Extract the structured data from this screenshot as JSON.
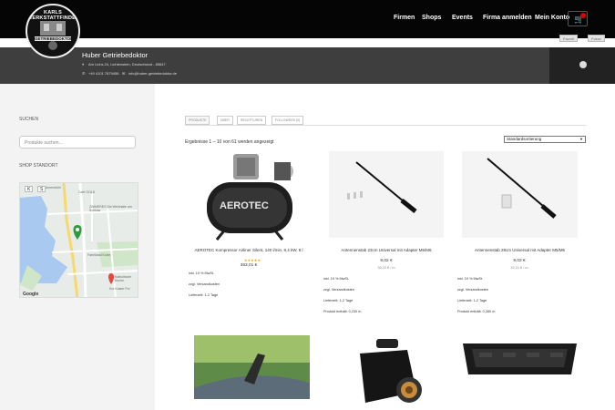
{
  "logo": {
    "top_text": "KARLS WERKSTATTFINDER",
    "middle_text": "GETRIEBEDOKTOR"
  },
  "nav": {
    "items": [
      "Firmen",
      "Shops",
      "Events",
      "Firma anmelden",
      "Mein Konto"
    ]
  },
  "toolbar": {
    "chips": [
      "Favorit",
      "Folow"
    ]
  },
  "shop": {
    "title": "Huber Getriebedoktor",
    "address": "Am Lichs 24, Lichtenstein, Deutschland - 85647",
    "phone": "+49 4101 7879456",
    "email": "info@huber-getriebedoktor.de"
  },
  "sidebar": {
    "search_heading": "SUCHEN",
    "search_placeholder": "Produkte suchen…",
    "map_heading": "SHOP STANDORT",
    "map_labels": [
      "Amernbühl",
      "Café GOLD",
      "ZIMMERES Die Weinhalle am Schloss",
      "Fabrikbad Kolbe",
      "Katholische Kirche",
      "Kur Kaiser Pol"
    ],
    "map_buttons": [
      "K",
      "S"
    ],
    "map_logo": "Google"
  },
  "tabs": [
    "PRODUKTE",
    "ÜBER",
    "RECEPTUREN",
    "FOLLOWERS (0)"
  ],
  "results_text": "Ergebnisse 1 – 10 von 61 werden angezeigt",
  "sort": {
    "selected": "Standardsortierung"
  },
  "products": [
    {
      "title": "AEROTEC Kompressor Airliner Silent, 140 l/min, 8,4 kW, 8 l",
      "price": "353,01 €",
      "stars": "★★★★★",
      "info": [
        "inkl. 19 % MwSt.",
        "zzgl. Versandkosten",
        "Lieferzeit: 1-2 Tage"
      ]
    },
    {
      "title": "Antennenstab 23cm Universal mit Adapter M5/M6",
      "price": "9,02 €",
      "unit": "39,22 € / m",
      "info": [
        "inkl. 19 % MwSt.",
        "zzgl. Versandkosten",
        "Lieferzeit: 1-2 Tage",
        "Produkt enthält: 0,230 m"
      ]
    },
    {
      "title": "Antennenstab 28cm Universal mit Adapter M5/M6",
      "price": "9,02 €",
      "unit": "32,21 € / m",
      "info": [
        "inkl. 19 % MwSt.",
        "zzgl. Versandkosten",
        "Lieferzeit: 1-2 Tage",
        "Produkt enthält: 0,280 m"
      ]
    }
  ],
  "product_brand": "AEROTEC",
  "colors": {
    "nav_bg": "#050505",
    "banner_bg": "#3e3e3e",
    "sidebar_bg": "#f3f3f3",
    "star": "#f4a300",
    "pin": "#2e9c3d"
  }
}
